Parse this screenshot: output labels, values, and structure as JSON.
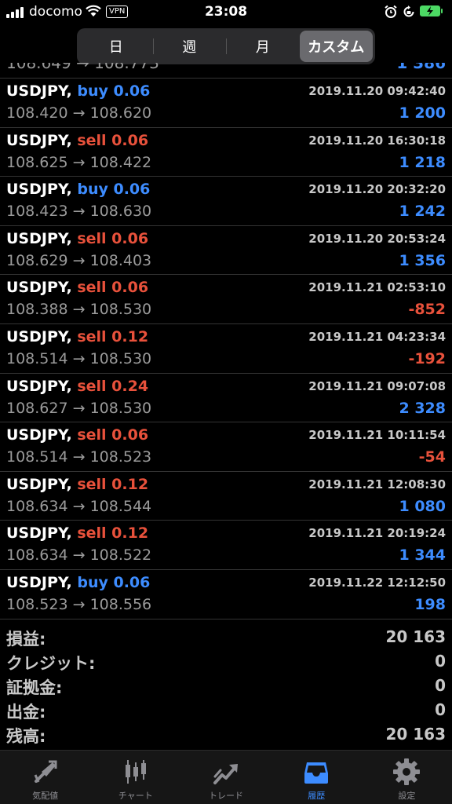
{
  "status_bar": {
    "carrier": "docomo",
    "vpn": "VPN",
    "time": "23:08"
  },
  "segments": [
    {
      "label": "日",
      "active": false
    },
    {
      "label": "週",
      "active": false
    },
    {
      "label": "月",
      "active": false
    },
    {
      "label": "カスタム",
      "active": true
    }
  ],
  "partial_row": {
    "left": "108.649 → 108.773",
    "right": "1 386"
  },
  "trades": [
    {
      "symbol": "USDJPY,",
      "side": "buy 0.06",
      "type": "buy",
      "time": "2019.11.20 09:42:40",
      "prices": "108.420 → 108.620",
      "profit": "1 200",
      "profit_sign": "pos"
    },
    {
      "symbol": "USDJPY,",
      "side": "sell 0.06",
      "type": "sell",
      "time": "2019.11.20 16:30:18",
      "prices": "108.625 → 108.422",
      "profit": "1 218",
      "profit_sign": "pos"
    },
    {
      "symbol": "USDJPY,",
      "side": "buy 0.06",
      "type": "buy",
      "time": "2019.11.20 20:32:20",
      "prices": "108.423 → 108.630",
      "profit": "1 242",
      "profit_sign": "pos"
    },
    {
      "symbol": "USDJPY,",
      "side": "sell 0.06",
      "type": "sell",
      "time": "2019.11.20 20:53:24",
      "prices": "108.629 → 108.403",
      "profit": "1 356",
      "profit_sign": "pos"
    },
    {
      "symbol": "USDJPY,",
      "side": "sell 0.06",
      "type": "sell",
      "time": "2019.11.21 02:53:10",
      "prices": "108.388 → 108.530",
      "profit": "-852",
      "profit_sign": "neg"
    },
    {
      "symbol": "USDJPY,",
      "side": "sell 0.12",
      "type": "sell",
      "time": "2019.11.21 04:23:34",
      "prices": "108.514 → 108.530",
      "profit": "-192",
      "profit_sign": "neg"
    },
    {
      "symbol": "USDJPY,",
      "side": "sell 0.24",
      "type": "sell",
      "time": "2019.11.21 09:07:08",
      "prices": "108.627 → 108.530",
      "profit": "2 328",
      "profit_sign": "pos"
    },
    {
      "symbol": "USDJPY,",
      "side": "sell 0.06",
      "type": "sell",
      "time": "2019.11.21 10:11:54",
      "prices": "108.514 → 108.523",
      "profit": "-54",
      "profit_sign": "neg"
    },
    {
      "symbol": "USDJPY,",
      "side": "sell 0.12",
      "type": "sell",
      "time": "2019.11.21 12:08:30",
      "prices": "108.634 → 108.544",
      "profit": "1 080",
      "profit_sign": "pos"
    },
    {
      "symbol": "USDJPY,",
      "side": "sell 0.12",
      "type": "sell",
      "time": "2019.11.21 20:19:24",
      "prices": "108.634 → 108.522",
      "profit": "1 344",
      "profit_sign": "pos"
    },
    {
      "symbol": "USDJPY,",
      "side": "buy 0.06",
      "type": "buy",
      "time": "2019.11.22 12:12:50",
      "prices": "108.523 → 108.556",
      "profit": "198",
      "profit_sign": "pos"
    }
  ],
  "summary": [
    {
      "label": "損益:",
      "value": "20 163"
    },
    {
      "label": "クレジット:",
      "value": "0"
    },
    {
      "label": "証拠金:",
      "value": "0"
    },
    {
      "label": "出金:",
      "value": "0"
    },
    {
      "label": "残高:",
      "value": "20 163"
    }
  ],
  "tabs": [
    {
      "label": "気配値",
      "icon": "quotes-icon",
      "active": false
    },
    {
      "label": "チャート",
      "icon": "chart-icon",
      "active": false
    },
    {
      "label": "トレード",
      "icon": "trade-icon",
      "active": false
    },
    {
      "label": "履歴",
      "icon": "history-icon",
      "active": true
    },
    {
      "label": "設定",
      "icon": "gear-icon",
      "active": false
    }
  ],
  "colors": {
    "buy": "#3d8cff",
    "sell": "#e8513b",
    "background": "#000000",
    "active_tab": "#3d8cff"
  }
}
